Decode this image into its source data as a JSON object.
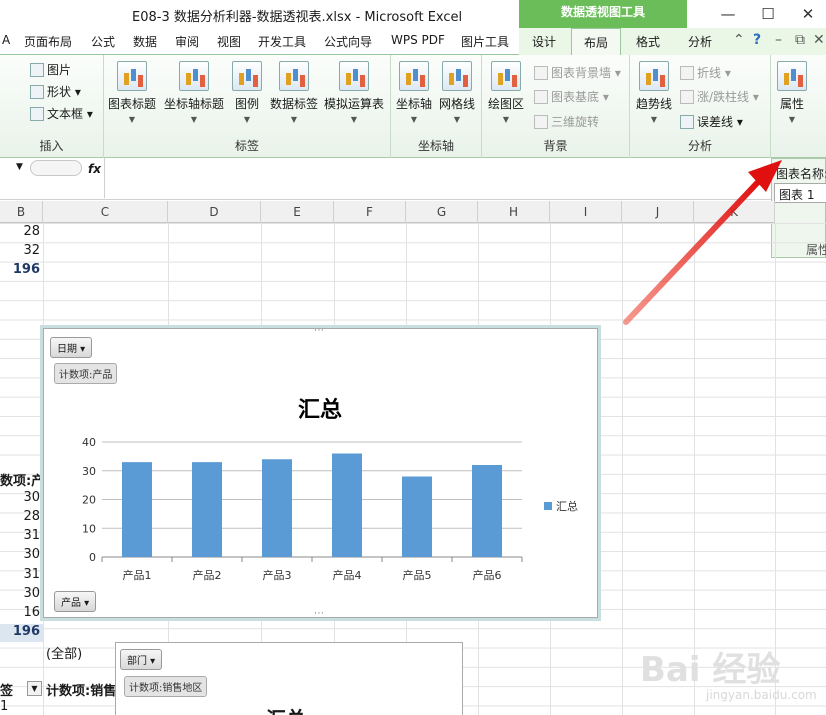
{
  "window": {
    "title": "E08-3 数据分析利器-数据透视表.xlsx - Microsoft Excel",
    "context_tab_header": "数据透视图工具",
    "minimize": "—",
    "restore": "☐",
    "close": "✕"
  },
  "tabs": {
    "page_layout": "页面布局",
    "formulas": "公式",
    "data": "数据",
    "review": "审阅",
    "view": "视图",
    "developer": "开发工具",
    "formula_wizard": "公式向导",
    "wps_pdf": "WPS PDF",
    "picture_tools": "图片工具",
    "design": "设计",
    "layout": "布局",
    "format": "格式",
    "analyze": "分析",
    "first_char": "A"
  },
  "ribbon": {
    "insert": {
      "label": "插入",
      "picture": "图片",
      "shapes": "形状",
      "textbox": "文本框"
    },
    "labels": {
      "label": "标签",
      "chart_title": "图表标题",
      "axis_titles": "坐标轴标题",
      "legend": "图例",
      "data_labels": "数据标签",
      "data_table": "模拟运算表"
    },
    "axes": {
      "label": "坐标轴",
      "axes": "坐标轴",
      "gridlines": "网格线"
    },
    "background": {
      "label": "背景",
      "plot_area": "绘图区",
      "chart_wall": "图表背景墙",
      "chart_floor": "图表基底",
      "rotation_3d": "三维旋转"
    },
    "analysis": {
      "label": "分析",
      "trendline": "趋势线",
      "lines": "折线",
      "updown_bars": "涨/跌柱线",
      "error_bars": "误差线"
    },
    "properties": {
      "label": "属性"
    }
  },
  "formula_bar": {
    "fx": "fx"
  },
  "properties_pane": {
    "chart_name_label": "图表名称:",
    "chart_name_value": "图表 1",
    "bottom_label": "属性"
  },
  "columns": [
    "B",
    "C",
    "D",
    "E",
    "F",
    "G",
    "H",
    "I",
    "J",
    "K"
  ],
  "cells": {
    "b1": "28",
    "b2": "32",
    "b3": "196",
    "left_header": "数项:产品",
    "b_list": [
      "30",
      "28",
      "31",
      "30",
      "31",
      "30",
      "16"
    ],
    "b_total": "196",
    "all_label": "(全部)",
    "row_label": "签",
    "count_label": "计数项:销售",
    "last_row": "1"
  },
  "chart": {
    "filter_date": "日期",
    "value_button": "计数项:产品",
    "filter_product": "产品",
    "legend_entry": "汇总"
  },
  "chart_data": {
    "type": "bar",
    "title": "汇总",
    "categories": [
      "产品1",
      "产品2",
      "产品3",
      "产品4",
      "产品5",
      "产品6"
    ],
    "series": [
      {
        "name": "汇总",
        "values": [
          33,
          33,
          34,
          36,
          28,
          32
        ],
        "color": "#5b9bd5"
      }
    ],
    "y_ticks": [
      "0",
      "10",
      "20",
      "30",
      "40"
    ],
    "ylim": [
      0,
      40
    ],
    "grid": true,
    "legend": "right"
  },
  "chart2": {
    "filter_dept": "部门",
    "value_button": "计数项:销售地区",
    "title": "汇总"
  },
  "watermark": {
    "brand": "Bai 经验",
    "url": "jingyan.baidu.com"
  }
}
